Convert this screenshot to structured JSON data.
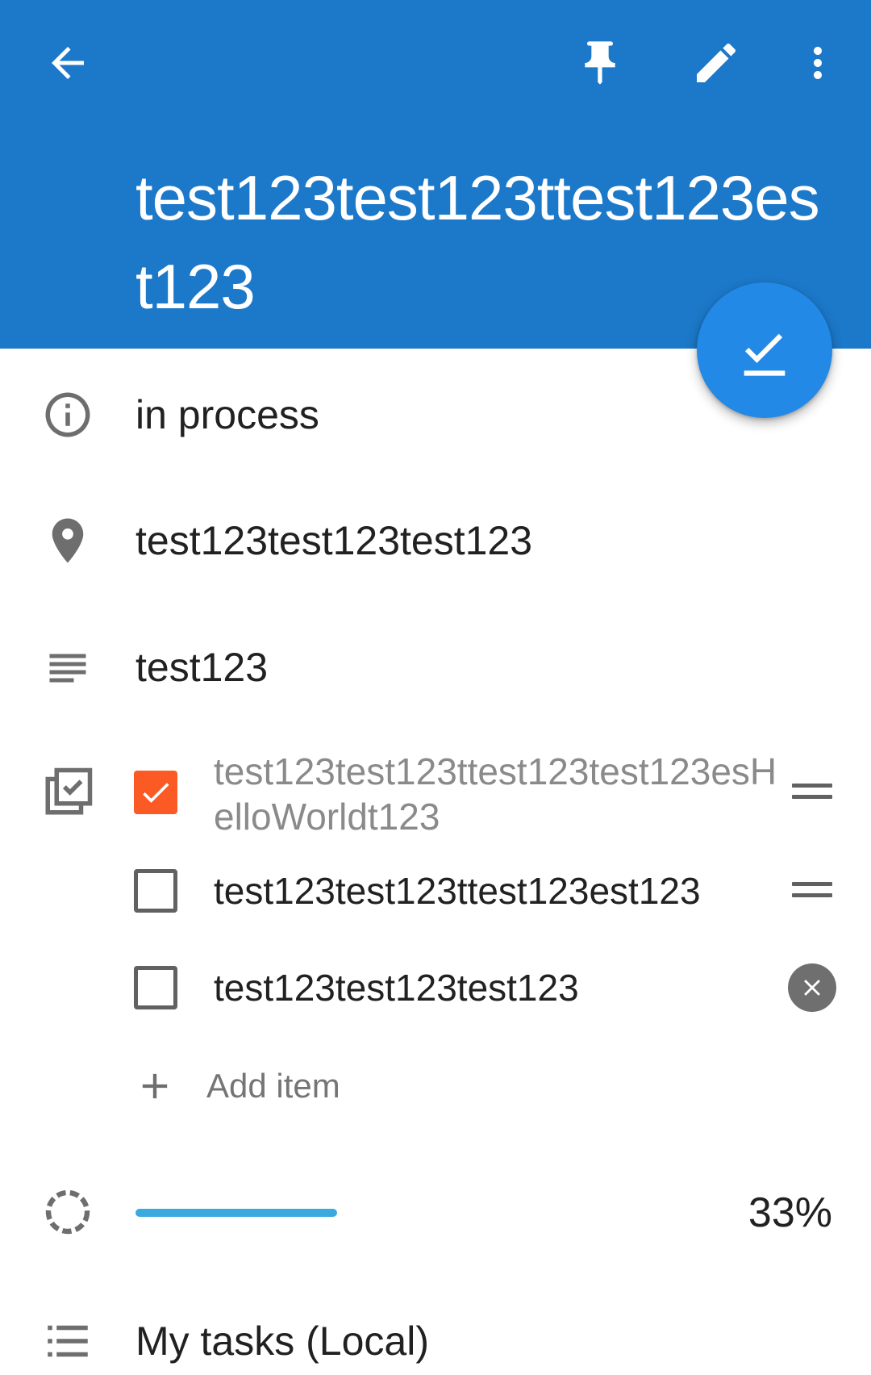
{
  "header": {
    "title": "test123test123ttest123est123",
    "icons": [
      "back-arrow-icon",
      "pin-icon",
      "edit-pencil-icon",
      "more-vert-icon"
    ],
    "color": "#1c78c8"
  },
  "fab": {
    "icon": "check-done-icon",
    "color": "#2289e6"
  },
  "status": {
    "icon": "info-icon",
    "text": "in process"
  },
  "location": {
    "icon": "location-pin-icon",
    "text": "test123test123test123"
  },
  "description": {
    "icon": "notes-lines-icon",
    "text": "test123"
  },
  "checklist": {
    "icon": "checklist-icon",
    "items": [
      {
        "text": "test123test123ttest123test123esHelloWorldt123",
        "checked": true
      },
      {
        "text": "test123test123ttest123est123",
        "checked": false
      },
      {
        "text": "test123test123test123",
        "checked": false
      }
    ],
    "add_label": "Add item",
    "checked_color": "#fb5a25"
  },
  "progress": {
    "icon": "progress-circle-icon",
    "value": 0.33,
    "label": "33%",
    "color": "#3aa9e0"
  },
  "list": {
    "icon": "list-bullets-icon",
    "text": "My tasks (Local)"
  }
}
